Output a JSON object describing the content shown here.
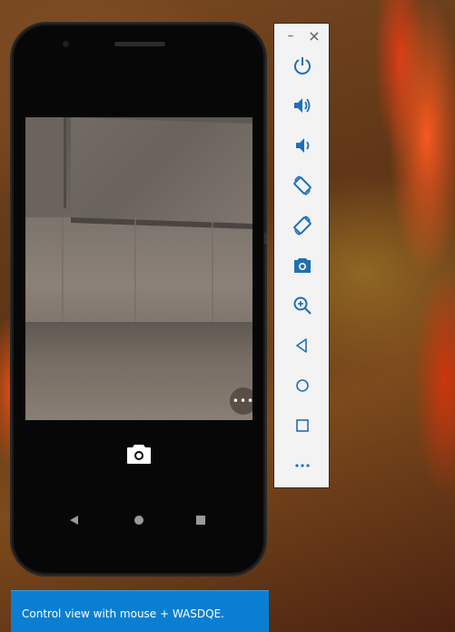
{
  "toolbar": {
    "minimize_glyph": "–",
    "close_glyph": "×",
    "items": [
      {
        "name": "power",
        "icon": "power-icon"
      },
      {
        "name": "volume-up",
        "icon": "volume-up-icon"
      },
      {
        "name": "volume-down",
        "icon": "volume-down-icon"
      },
      {
        "name": "rotate-left",
        "icon": "rotate-left-icon"
      },
      {
        "name": "rotate-right",
        "icon": "rotate-right-icon"
      },
      {
        "name": "screenshot",
        "icon": "camera-icon"
      },
      {
        "name": "zoom",
        "icon": "zoom-in-icon"
      },
      {
        "name": "back",
        "icon": "back-triangle-icon"
      },
      {
        "name": "home",
        "icon": "home-circle-icon"
      },
      {
        "name": "overview",
        "icon": "overview-square-icon"
      },
      {
        "name": "more",
        "icon": "more-dots-icon"
      }
    ]
  },
  "camera_app": {
    "more_glyph": "•••"
  },
  "tooltip": {
    "text": "Control view with mouse + WASDQE."
  },
  "colors": {
    "toolbar_icon": "#1f6fb5",
    "tooltip_bg": "#0a7fd1"
  }
}
